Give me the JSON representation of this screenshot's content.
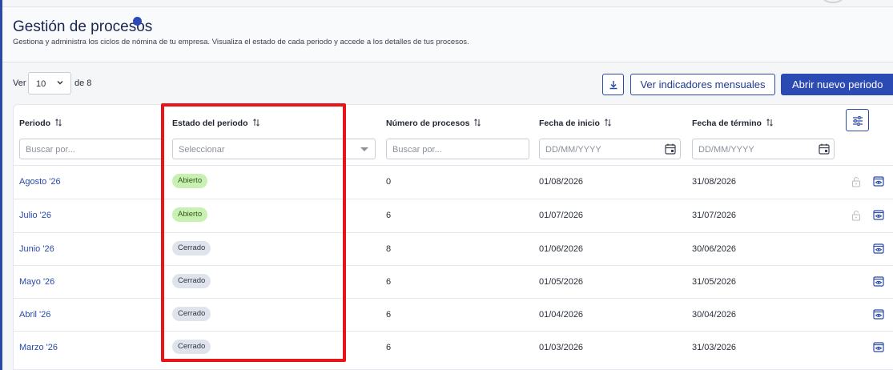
{
  "header": {
    "title": "Gestión de procesos",
    "subtitle": "Gestiona y administra los ciclos de nómina de tu empresa. Visualiza el estado de cada periodo y accede a los detalles de tus procesos."
  },
  "pagination": {
    "ver_label": "Ver",
    "page_size": "10",
    "total_label": "de 8"
  },
  "actions": {
    "indicators_label": "Ver indicadores mensuales",
    "new_period_label": "Abrir nuevo periodo"
  },
  "table": {
    "columns": [
      "Periodo",
      "Estado del periodo",
      "Número de procesos",
      "Fecha de inicio",
      "Fecha de término"
    ],
    "filters": {
      "period_placeholder": "Buscar por...",
      "status_placeholder": "Seleccionar",
      "processes_placeholder": "Buscar por...",
      "start_placeholder": "DD/MM/YYYY",
      "end_placeholder": "DD/MM/YYYY"
    },
    "rows": [
      {
        "period": "Agosto '26",
        "status": "Abierto",
        "processes": "0",
        "start": "01/08/2026",
        "end": "31/08/2026"
      },
      {
        "period": "Julio '26",
        "status": "Abierto",
        "processes": "6",
        "start": "01/07/2026",
        "end": "31/07/2026"
      },
      {
        "period": "Junio '26",
        "status": "Cerrado",
        "processes": "8",
        "start": "01/06/2026",
        "end": "30/06/2026"
      },
      {
        "period": "Mayo '26",
        "status": "Cerrado",
        "processes": "6",
        "start": "01/05/2026",
        "end": "31/05/2026"
      },
      {
        "period": "Abril '26",
        "status": "Cerrado",
        "processes": "6",
        "start": "01/04/2026",
        "end": "30/04/2026"
      },
      {
        "period": "Marzo '26",
        "status": "Cerrado",
        "processes": "6",
        "start": "01/03/2026",
        "end": "31/03/2026"
      }
    ]
  },
  "colors": {
    "primary": "#2c4ab3",
    "open_badge": "#c9f0b3",
    "closed_badge": "#dfe4ec",
    "highlight": "#e8141a"
  },
  "icons": [
    "download-icon",
    "chevron-down-icon",
    "sort-icon",
    "calendar-icon",
    "columns-settings-icon",
    "lock-icon",
    "eye-icon"
  ]
}
